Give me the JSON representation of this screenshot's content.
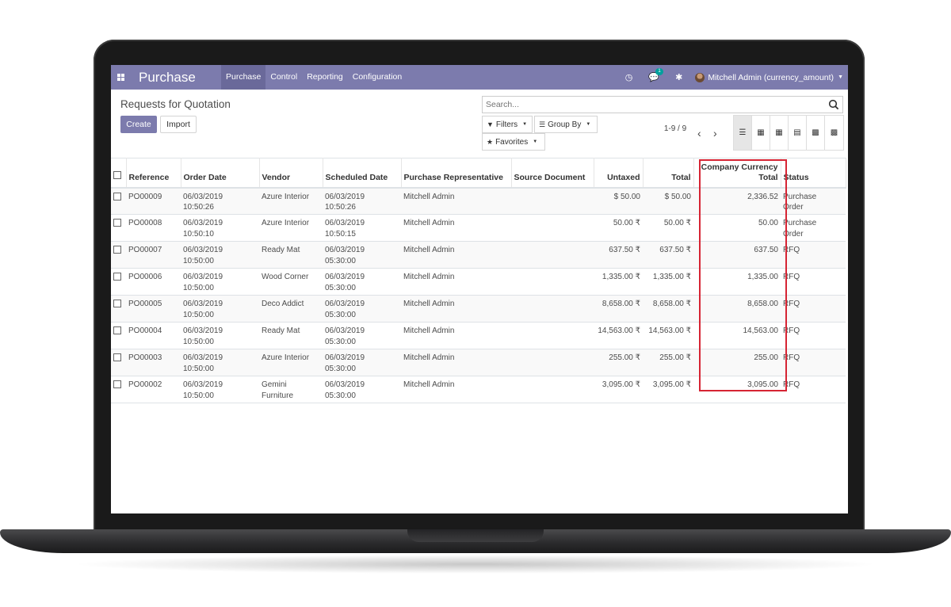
{
  "app": {
    "brand": "Purchase",
    "menu": [
      "Purchase",
      "Control",
      "Reporting",
      "Configuration"
    ],
    "active_menu_index": 0,
    "messages_badge": "1",
    "user": "Mitchell Admin (currency_amount)",
    "nav_color": "#7c7bad"
  },
  "control_panel": {
    "title": "Requests for Quotation",
    "create_label": "Create",
    "import_label": "Import",
    "search_placeholder": "Search...",
    "filters_label": "Filters",
    "groupby_label": "Group By",
    "favorites_label": "Favorites",
    "pager": "1-9 / 9",
    "views": [
      "list-view-icon",
      "kanban-view-icon",
      "pivot-view-icon",
      "graph-view-icon",
      "calendar-view-icon",
      "grid-view-icon"
    ],
    "active_view_index": 0
  },
  "table": {
    "columns": [
      "Reference",
      "Order Date",
      "Vendor",
      "Scheduled Date",
      "Purchase Representative",
      "Source Document",
      "Untaxed",
      "Total",
      "Company Currency Total",
      "Status"
    ],
    "rows": [
      [
        "PO00009",
        "06/03/2019\n10:50:26",
        "Azure Interior",
        "06/03/2019\n10:50:26",
        "Mitchell Admin",
        "",
        "$ 50.00",
        "$ 50.00",
        "2,336.52",
        "Purchase\nOrder"
      ],
      [
        "PO00008",
        "06/03/2019\n10:50:10",
        "Azure Interior",
        "06/03/2019\n10:50:15",
        "Mitchell Admin",
        "",
        "50.00 ₹",
        "50.00 ₹",
        "50.00",
        "Purchase\nOrder"
      ],
      [
        "PO00007",
        "06/03/2019\n10:50:00",
        "Ready Mat",
        "06/03/2019\n05:30:00",
        "Mitchell Admin",
        "",
        "637.50 ₹",
        "637.50 ₹",
        "637.50",
        "RFQ"
      ],
      [
        "PO00006",
        "06/03/2019\n10:50:00",
        "Wood Corner",
        "06/03/2019\n05:30:00",
        "Mitchell Admin",
        "",
        "1,335.00 ₹",
        "1,335.00 ₹",
        "1,335.00",
        "RFQ"
      ],
      [
        "PO00005",
        "06/03/2019\n10:50:00",
        "Deco Addict",
        "06/03/2019\n05:30:00",
        "Mitchell Admin",
        "",
        "8,658.00 ₹",
        "8,658.00 ₹",
        "8,658.00",
        "RFQ"
      ],
      [
        "PO00004",
        "06/03/2019\n10:50:00",
        "Ready Mat",
        "06/03/2019\n05:30:00",
        "Mitchell Admin",
        "",
        "14,563.00 ₹",
        "14,563.00 ₹",
        "14,563.00",
        "RFQ"
      ],
      [
        "PO00003",
        "06/03/2019\n10:50:00",
        "Azure Interior",
        "06/03/2019\n05:30:00",
        "Mitchell Admin",
        "",
        "255.00 ₹",
        "255.00 ₹",
        "255.00",
        "RFQ"
      ],
      [
        "PO00002",
        "06/03/2019\n10:50:00",
        "Gemini\nFurniture",
        "06/03/2019\n05:30:00",
        "Mitchell Admin",
        "",
        "3,095.00 ₹",
        "3,095.00 ₹",
        "3,095.00",
        "RFQ"
      ]
    ],
    "highlight_color": "#d62433"
  }
}
